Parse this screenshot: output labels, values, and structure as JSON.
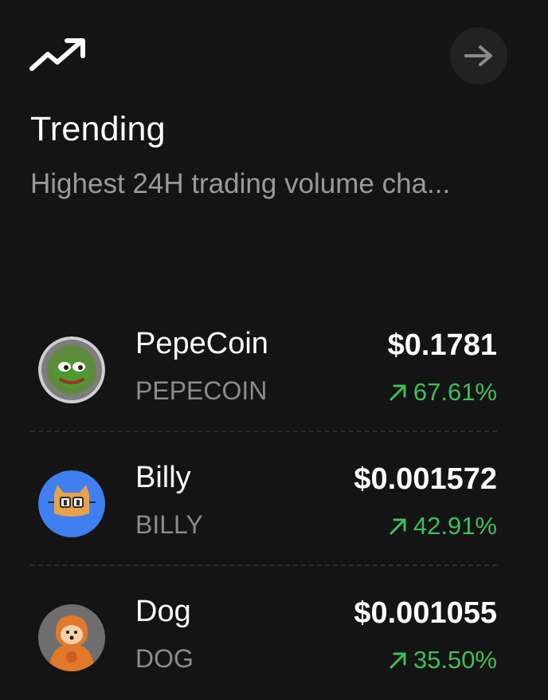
{
  "header": {
    "icon": "trending-up-icon",
    "action_icon": "arrow-right-icon"
  },
  "section": {
    "title": "Trending",
    "subtitle": "Highest 24H trading volume cha..."
  },
  "colors": {
    "background": "#141414",
    "positive": "#3fbf5a",
    "muted_text": "#9a9a9a"
  },
  "coins": [
    {
      "name": "PepeCoin",
      "symbol": "PEPECOIN",
      "price": "$0.1781",
      "change": "67.61%",
      "change_icon": "arrow-up-right-icon",
      "avatar": "pepecoin-logo"
    },
    {
      "name": "Billy",
      "symbol": "BILLY",
      "price": "$0.001572",
      "change": "42.91%",
      "change_icon": "arrow-up-right-icon",
      "avatar": "billy-logo"
    },
    {
      "name": "Dog",
      "symbol": "DOG",
      "price": "$0.001055",
      "change": "35.50%",
      "change_icon": "arrow-up-right-icon",
      "avatar": "dog-logo"
    }
  ]
}
